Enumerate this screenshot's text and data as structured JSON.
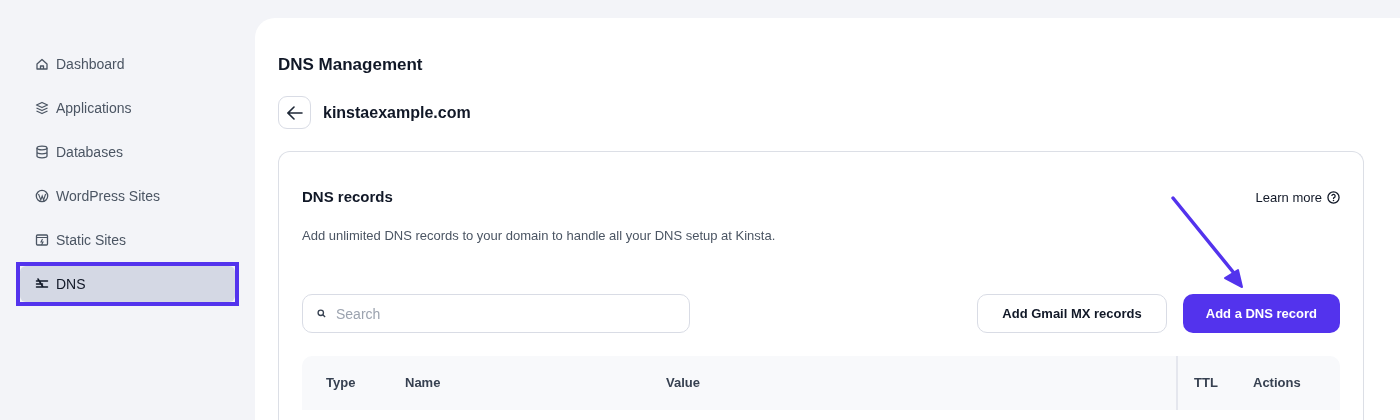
{
  "sidebar": {
    "items": [
      {
        "label": "Dashboard",
        "kind": "home",
        "selected": false,
        "highlighted": false
      },
      {
        "label": "Applications",
        "kind": "layers",
        "selected": false,
        "highlighted": false
      },
      {
        "label": "Databases",
        "kind": "database",
        "selected": false,
        "highlighted": false
      },
      {
        "label": "WordPress Sites",
        "kind": "wordpress",
        "selected": false,
        "highlighted": false
      },
      {
        "label": "Static Sites",
        "kind": "static",
        "selected": false,
        "highlighted": false
      },
      {
        "label": "DNS",
        "kind": "dns",
        "selected": true,
        "highlighted": true
      }
    ]
  },
  "page": {
    "title": "DNS Management",
    "domain": "kinstaexample.com"
  },
  "records": {
    "title": "DNS records",
    "learn_more": "Learn more",
    "description": "Add unlimited DNS records to your domain to handle all your DNS setup at Kinsta.",
    "search": {
      "placeholder": "Search"
    },
    "buttons": [
      {
        "label": "Add Gmail MX records",
        "kind": "secondary"
      },
      {
        "label": "Add a DNS record",
        "kind": "primary",
        "pointed_at": true
      }
    ],
    "table": {
      "columns": [
        "Type",
        "Name",
        "Value",
        "TTL",
        "Actions"
      ]
    }
  }
}
